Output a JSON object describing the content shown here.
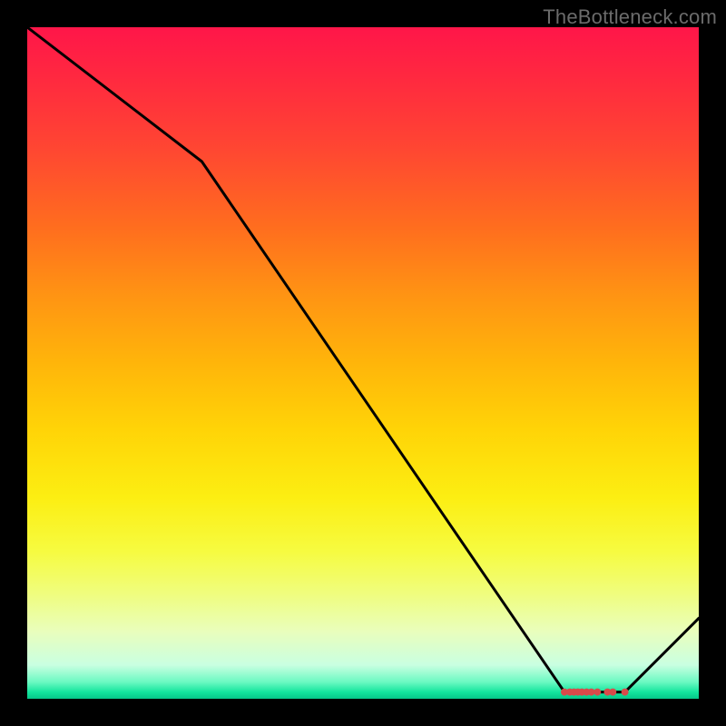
{
  "attribution": "TheBottleneck.com",
  "chart_data": {
    "type": "line",
    "title": "",
    "xlabel": "",
    "ylabel": "",
    "xlim": [
      0,
      100
    ],
    "ylim": [
      0,
      100
    ],
    "series": [
      {
        "name": "bottleneck-curve",
        "x": [
          0,
          26,
          80,
          89,
          100
        ],
        "y": [
          100,
          80,
          1,
          1,
          12
        ]
      }
    ],
    "markers": {
      "name": "optimal-range-dots",
      "color": "#d94a4a",
      "x": [
        80.0,
        80.8,
        81.4,
        82.0,
        82.6,
        83.3,
        84.0,
        84.9,
        86.4,
        87.2,
        89.0
      ],
      "y": [
        1,
        1,
        1,
        1,
        1,
        1,
        1,
        1,
        1,
        1,
        1
      ]
    }
  }
}
